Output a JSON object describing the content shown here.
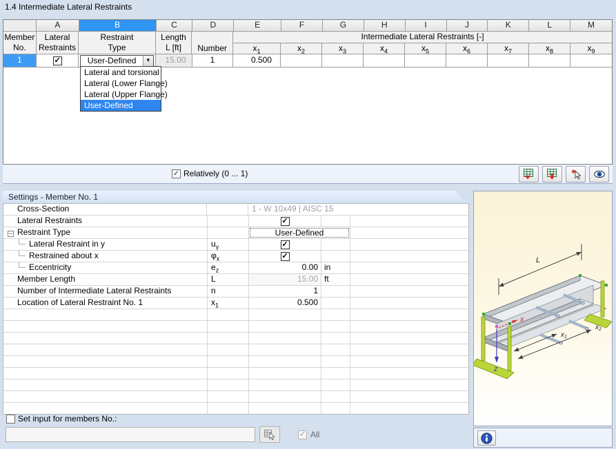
{
  "title": "1.4 Intermediate Lateral Restraints",
  "table": {
    "letters": [
      "A",
      "B",
      "C",
      "D",
      "E",
      "F",
      "G",
      "H",
      "I",
      "J",
      "K",
      "L",
      "M"
    ],
    "selected_letter": "B",
    "corner": {
      "line1": "Member",
      "line2": "No."
    },
    "headers": {
      "a1": "Lateral",
      "a2": "Restraints",
      "b1": "Restraint",
      "b2": "Type",
      "c1": "Length",
      "c2": "L [ft]",
      "d": "Number",
      "group": "Intermediate Lateral Restraints [-]",
      "x_base": "x",
      "x_subs": [
        "1",
        "2",
        "3",
        "4",
        "5",
        "6",
        "7",
        "8",
        "9"
      ]
    },
    "row": {
      "member": "1",
      "lateral_checked": true,
      "restraint_type": "User-Defined",
      "length": "15.00",
      "number": "1",
      "x1": "0.500"
    }
  },
  "dropdown": {
    "items": [
      "Lateral and torsional",
      "Lateral (Lower Flange)",
      "Lateral (Upper Flange)",
      "User-Defined"
    ],
    "selected": "User-Defined"
  },
  "relatively_label": "Relatively (0 ... 1)",
  "toolbar": {
    "buttons": [
      {
        "icon": "excel-import-icon"
      },
      {
        "icon": "excel-export-icon"
      },
      {
        "icon": "pick-members-icon"
      },
      {
        "icon": "view-icon"
      }
    ]
  },
  "settings": {
    "header": "Settings - Member No. 1",
    "rows": [
      {
        "label": "Cross-Section",
        "type": "text",
        "value": "1 - W 10x49 | AISC 15"
      },
      {
        "label": "Lateral Restraints",
        "type": "check",
        "checked": true
      },
      {
        "label": "Restraint Type",
        "collapse": true,
        "type": "combo",
        "value": "User-Defined"
      },
      {
        "label": "Lateral Restraint in y",
        "child": true,
        "sym": "u",
        "sub": "y",
        "type": "check",
        "checked": true
      },
      {
        "label": "Restrained about x",
        "child": true,
        "sym": "φ",
        "sub": "x",
        "type": "check",
        "checked": true
      },
      {
        "label": "Eccentricity",
        "child": true,
        "sym": "e",
        "sub": "z",
        "type": "num",
        "value": "0.00",
        "unit": "in"
      },
      {
        "label": "Member Length",
        "sym": "L",
        "type": "num",
        "value": "15.00",
        "unit": "ft",
        "disabled": true
      },
      {
        "label": "Number of Intermediate Lateral Restraints",
        "sym": "n",
        "type": "num",
        "value": "1"
      },
      {
        "label": "Location of Lateral Restraint No. 1",
        "sym": "x",
        "sub": "1",
        "type": "num",
        "value": "0.500"
      }
    ],
    "empty_rows": 9
  },
  "footer": {
    "set_input_label": "Set input for members No.:",
    "input_value": "",
    "all_label": "All"
  },
  "diagram": {
    "labels": {
      "length": "L",
      "axis_x": "x",
      "axis_z": "z",
      "x1_base": "x",
      "x1_sub": "1",
      "x2_base": "x",
      "x2_sub": "2"
    }
  },
  "colors": {
    "accent_blue": "#2f95f3",
    "selection_blue": "#2f86f0",
    "dialog_bg": "#d4e0ee",
    "diagram_bg": "#fcf6dd",
    "support_green": "#b9d53a",
    "axis_red": "#e02818",
    "axis_blue": "#4038c0"
  }
}
